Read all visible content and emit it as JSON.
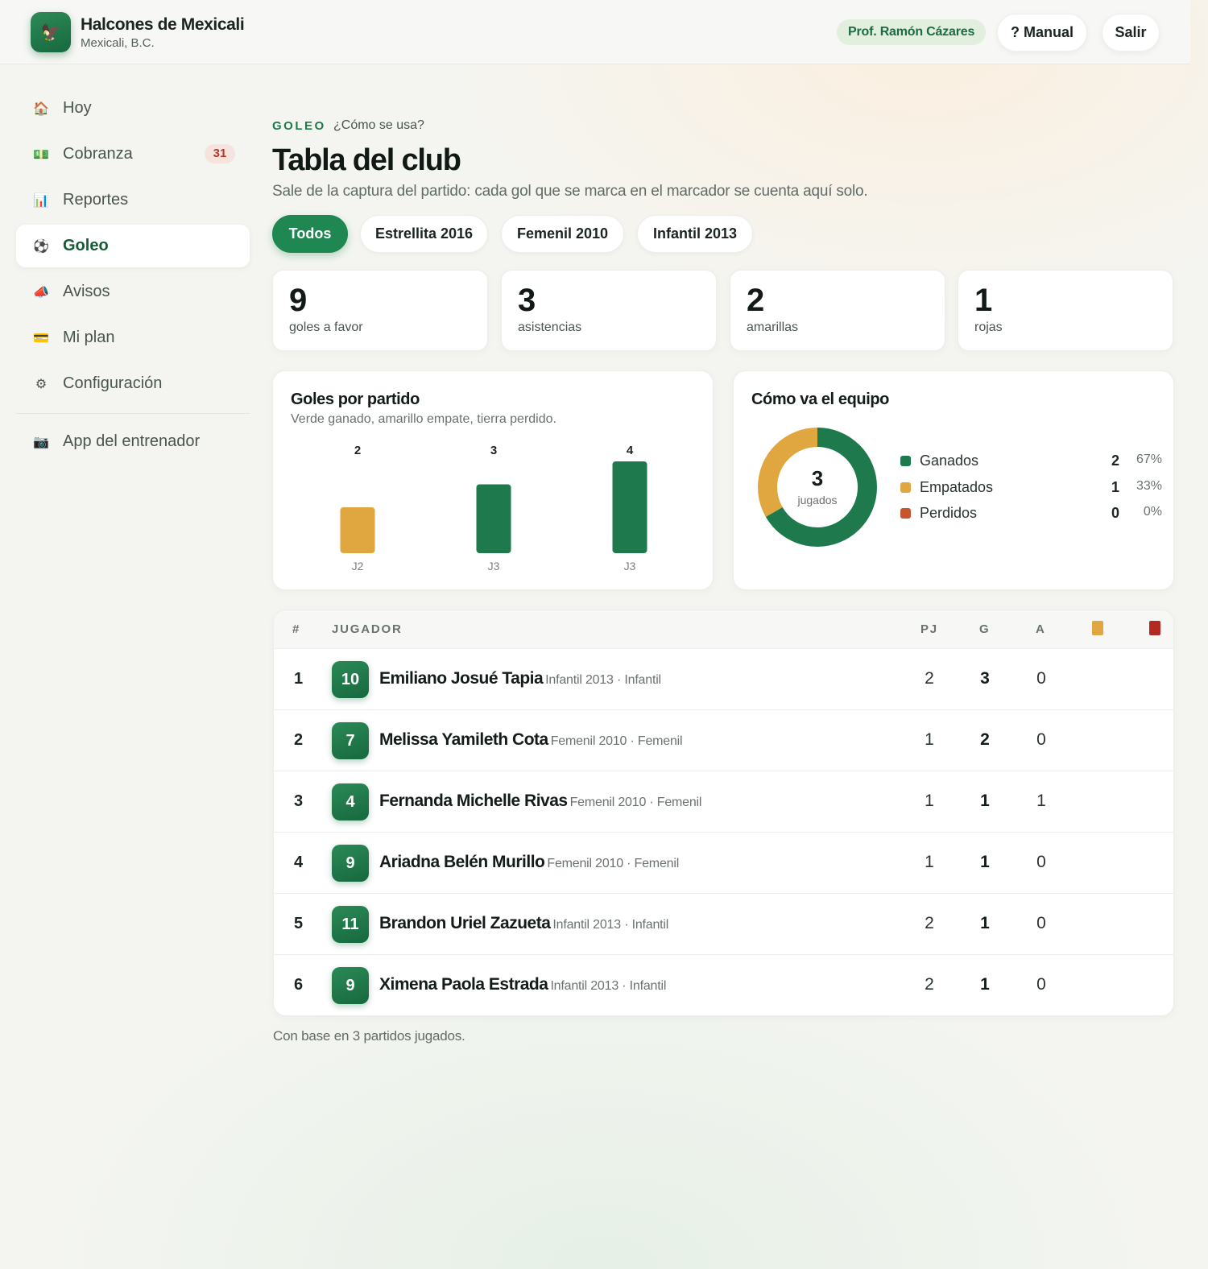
{
  "brand": {
    "name": "Halcones de Mexicali",
    "city": "Mexicali, B.C.",
    "logo_icon": "🦅"
  },
  "header": {
    "profile": "Prof. Ramón Cázares",
    "manual": "? Manual",
    "logout": "Salir"
  },
  "sidebar": {
    "items": [
      {
        "label": "Hoy",
        "icon": "🏠",
        "icon_name": "home-icon"
      },
      {
        "label": "Cobranza",
        "icon": "💵",
        "icon_name": "money-icon",
        "badge": "31"
      },
      {
        "label": "Reportes",
        "icon": "📊",
        "icon_name": "bar-chart-icon"
      },
      {
        "label": "Goleo",
        "icon": "⚽",
        "icon_name": "ball-icon",
        "active": true
      },
      {
        "label": "Avisos",
        "icon": "📣",
        "icon_name": "megaphone-icon"
      },
      {
        "label": "Mi plan",
        "icon": "💳",
        "icon_name": "credit-card-icon"
      },
      {
        "label": "Configuración",
        "icon": "⚙",
        "icon_name": "gear-icon"
      }
    ],
    "coach_app": {
      "label": "App del entrenador",
      "icon": "📷",
      "icon_name": "camera-icon"
    }
  },
  "page": {
    "eyebrow": "GOLEO",
    "howto": "¿Cómo se usa?",
    "title": "Tabla del club",
    "subtitle": "Sale de la captura del partido: cada gol que se marca en el marcador se cuenta aquí solo."
  },
  "filters": [
    {
      "label": "Todos",
      "active": true
    },
    {
      "label": "Estrellita 2016"
    },
    {
      "label": "Femenil 2010"
    },
    {
      "label": "Infantil 2013"
    }
  ],
  "stats": [
    {
      "value": "9",
      "label": "goles a favor"
    },
    {
      "value": "3",
      "label": "asistencias"
    },
    {
      "value": "2",
      "label": "amarillas"
    },
    {
      "value": "1",
      "label": "rojas"
    }
  ],
  "goals_chart": {
    "title": "Goles por partido",
    "subtitle": "Verde ganado, amarillo empate, tierra perdido."
  },
  "team_chart": {
    "title": "Cómo va el equipo",
    "center_value": "3",
    "center_label": "jugados"
  },
  "chart_data": [
    {
      "type": "bar",
      "title": "Goles por partido",
      "categories": [
        "J2",
        "J3",
        "J3"
      ],
      "values": [
        2,
        3,
        4
      ],
      "results": [
        "empate",
        "ganado",
        "ganado"
      ],
      "ylim": [
        0,
        4
      ]
    },
    {
      "type": "pie",
      "title": "Cómo va el equipo",
      "labels": [
        "Ganados",
        "Empatados",
        "Perdidos"
      ],
      "values": [
        2,
        1,
        0
      ],
      "percents": [
        "67%",
        "33%",
        "0%"
      ],
      "colors": [
        "#1e7a4c",
        "#e0a63f",
        "#c8552e"
      ]
    }
  ],
  "colors": {
    "win": "#1e7a4c",
    "draw": "#e0a63f",
    "loss": "#c8552e",
    "yellow_card": "#e0a63f",
    "red_card": "#b22a22"
  },
  "table": {
    "headers": {
      "rank": "#",
      "player": "JUGADOR",
      "pj": "PJ",
      "g": "G",
      "a": "A"
    },
    "rows": [
      {
        "rank": "1",
        "jersey": "10",
        "name": "Emiliano Josué Tapia",
        "meta": "Infantil 2013 · Infantil",
        "pj": "2",
        "g": "3",
        "a": "0"
      },
      {
        "rank": "2",
        "jersey": "7",
        "name": "Melissa Yamileth Cota",
        "meta": "Femenil 2010 · Femenil",
        "pj": "1",
        "g": "2",
        "a": "0"
      },
      {
        "rank": "3",
        "jersey": "4",
        "name": "Fernanda Michelle Rivas",
        "meta": "Femenil 2010 · Femenil",
        "pj": "1",
        "g": "1",
        "a": "1"
      },
      {
        "rank": "4",
        "jersey": "9",
        "name": "Ariadna Belén Murillo",
        "meta": "Femenil 2010 · Femenil",
        "pj": "1",
        "g": "1",
        "a": "0"
      },
      {
        "rank": "5",
        "jersey": "11",
        "name": "Brandon Uriel Zazueta",
        "meta": "Infantil 2013 · Infantil",
        "pj": "2",
        "g": "1",
        "a": "0"
      },
      {
        "rank": "6",
        "jersey": "9",
        "name": "Ximena Paola Estrada",
        "meta": "Infantil 2013 · Infantil",
        "pj": "2",
        "g": "1",
        "a": "0"
      }
    ]
  },
  "footnote": "Con base en 3 partidos jugados."
}
